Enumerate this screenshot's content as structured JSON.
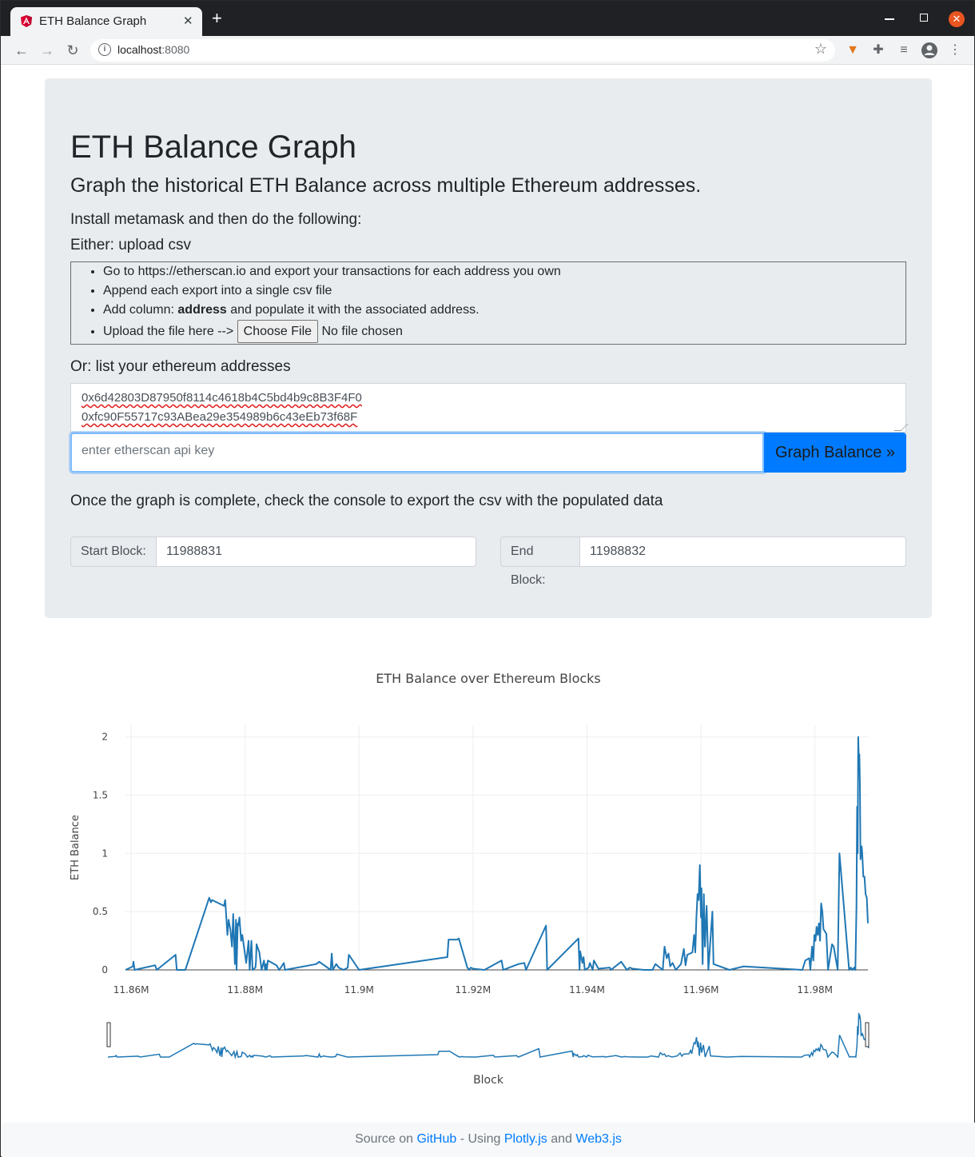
{
  "browser": {
    "tab_title": "ETH Balance Graph",
    "url_host": "localhost",
    "url_port": ":8080"
  },
  "hero": {
    "title": "ETH Balance Graph",
    "lead": "Graph the historical ETH Balance across multiple Ethereum addresses.",
    "install_strong": "Install metamask",
    "install_rest": " and then do the following:",
    "either_strong": "Either",
    "either_rest": ": upload csv",
    "steps": [
      "Go to https://etherscan.io and export your transactions for each address you own",
      "Append each export into a single csv file"
    ],
    "step3_prefix": "Add column: ",
    "step3_strong": "address",
    "step3_suffix": " and populate it with the associated address.",
    "upload_label": "Upload the file here -->",
    "choose_file": "Choose File",
    "no_file": "No file chosen",
    "or_strong": "Or",
    "or_rest": ": list your ethereum addresses",
    "addresses": [
      "0x6d42803D87950f8114c4618b4C5bd4b9c8B3F4F0",
      "0xfc90F55717c93ABea29e354989b6c43eEb73f68F"
    ],
    "api_placeholder": "enter etherscan api key",
    "graph_button": "Graph Balance »",
    "once_prefix": "Once the graph is complete, check the console to ",
    "once_strong": "export",
    "once_suffix": " the csv with the populated data",
    "start_label": "Start Block:",
    "start_value": "11988831",
    "end_label": "End Block:",
    "end_value": "11988832"
  },
  "footer": {
    "prefix": "Source on ",
    "github": "GitHub",
    "middle": " - Using ",
    "plotly": "Plotly.js",
    "and": " and ",
    "web3": "Web3.js"
  },
  "colors": {
    "line": "#1f77b4",
    "button": "#007bff",
    "jumbotron": "#e9ecef"
  },
  "chart_data": {
    "type": "line",
    "title": "ETH Balance over Ethereum Blocks",
    "xlabel": "Block",
    "ylabel": "ETH Balance",
    "xlim": [
      11859000,
      11989300
    ],
    "ylim": [
      0,
      2.1
    ],
    "xticks": [
      11860000,
      11880000,
      11900000,
      11920000,
      11940000,
      11960000,
      11980000
    ],
    "xtick_labels": [
      "11.86M",
      "11.88M",
      "11.9M",
      "11.92M",
      "11.94M",
      "11.96M",
      "11.98M"
    ],
    "yticks": [
      0,
      0.5,
      1,
      1.5,
      2
    ],
    "ytick_labels": [
      "0",
      "0.5",
      "1",
      "1.5",
      "2"
    ],
    "grid": true,
    "rangeslider": true,
    "series": [
      {
        "x": [
          11859000,
          11860300,
          11860400,
          11860600,
          11864200,
          11864500,
          11867800,
          11868000,
          11869500,
          11873700,
          11874000,
          11874200,
          11876300,
          11876500,
          11876900,
          11877100,
          11877400,
          11877700,
          11877900,
          11878200,
          11878400,
          11878500,
          11878700,
          11878800,
          11879000,
          11879300,
          11879500,
          11880200,
          11880600,
          11880800,
          11881100,
          11881300,
          11881800,
          11881900,
          11882000,
          11882500,
          11882900,
          11883300,
          11883500,
          11883700,
          11883800,
          11884000,
          11885500,
          11886000,
          11886800,
          11887000,
          11892500,
          11893000,
          11895000,
          11895200,
          11895400,
          11896000,
          11896400,
          11897300,
          11898000,
          11898200,
          11900000,
          11915500,
          11915700,
          11917000,
          11917200,
          11917500,
          11919000,
          11919300,
          11919600,
          11920000,
          11922000,
          11925000,
          11925300,
          11928000,
          11929000,
          11929300,
          11932800,
          11932900,
          11933000,
          11938500,
          11938700,
          11938800,
          11939200,
          11939400,
          11939600,
          11940300,
          11940500,
          11941000,
          11941200,
          11942000,
          11944000,
          11944200,
          11946000,
          11947000,
          11947500,
          11948000,
          11950000,
          11951500,
          11952000,
          11953300,
          11953600,
          11954000,
          11954300,
          11954600,
          11955000,
          11955300,
          11955600,
          11956500,
          11957000,
          11957300,
          11957600,
          11958500,
          11958800,
          11959000,
          11959200,
          11959400,
          11959600,
          11959800,
          11960000,
          11960100,
          11960300,
          11960500,
          11960700,
          11961000,
          11961300,
          11962000,
          11962200,
          11965000,
          11967500,
          11977800,
          11978000,
          11978300,
          11979000,
          11979200,
          11979500,
          11979700,
          11979900,
          11980100,
          11980300,
          11980500,
          11980700,
          11980900,
          11981100,
          11981300,
          11981500,
          11982000,
          11982300,
          11983000,
          11983300,
          11984000,
          11984300,
          11986000,
          11986300,
          11986600,
          11986900,
          11987100,
          11987300,
          11987400,
          11987500,
          11987600,
          11987700,
          11987800,
          11987900,
          11988000,
          11988200,
          11988300,
          11988500,
          11988700,
          11988900,
          11989100,
          11989300
        ],
        "y": [
          0,
          0.03,
          0.07,
          0,
          0.04,
          0,
          0.13,
          0,
          0,
          0.62,
          0.58,
          0.6,
          0.55,
          0.6,
          0.3,
          0.43,
          0.35,
          0.2,
          0.48,
          0.05,
          0.43,
          0,
          0.4,
          0.38,
          0.45,
          0.25,
          0.3,
          0.06,
          0.25,
          0,
          0.25,
          0,
          0.02,
          0.07,
          0.22,
          0.15,
          0,
          0.08,
          0,
          0.05,
          0,
          0.08,
          0.04,
          0,
          0.06,
          0,
          0.05,
          0.07,
          0,
          0.14,
          0,
          0.05,
          0.02,
          0,
          0.02,
          0.13,
          0,
          0.11,
          0.26,
          0.26,
          0.26,
          0.27,
          0.02,
          0,
          0.02,
          0.01,
          0,
          0.08,
          0,
          0.05,
          0.06,
          0,
          0.38,
          0.23,
          0,
          0.27,
          0,
          0.16,
          0.06,
          0.11,
          0,
          0.02,
          0.06,
          0,
          0.08,
          0.01,
          0.02,
          0,
          0.07,
          0,
          0.02,
          0.01,
          0,
          0,
          0.05,
          0,
          0.2,
          0.1,
          0.14,
          0.03,
          0.06,
          0.03,
          0,
          0.05,
          0.18,
          0.04,
          0.13,
          0.15,
          0.3,
          0.15,
          0.45,
          0.65,
          0.6,
          0.9,
          0.45,
          0.7,
          0.05,
          0.65,
          0.2,
          0.55,
          0,
          0.5,
          0.05,
          0,
          0.03,
          0,
          0.03,
          0.08,
          0.1,
          0,
          0.2,
          0.08,
          0.3,
          0.25,
          0.37,
          0.3,
          0.4,
          0.25,
          0.57,
          0.5,
          0.35,
          0.31,
          0,
          0.22,
          0.2,
          0,
          1.0,
          0,
          0.02,
          0,
          0.02,
          0,
          0.55,
          1.4,
          1.0,
          2.0,
          1.8,
          1.85,
          1.6,
          0.95,
          1.06,
          1.0,
          0.8,
          0.8,
          0.65,
          0.62,
          0.4
        ]
      }
    ]
  }
}
